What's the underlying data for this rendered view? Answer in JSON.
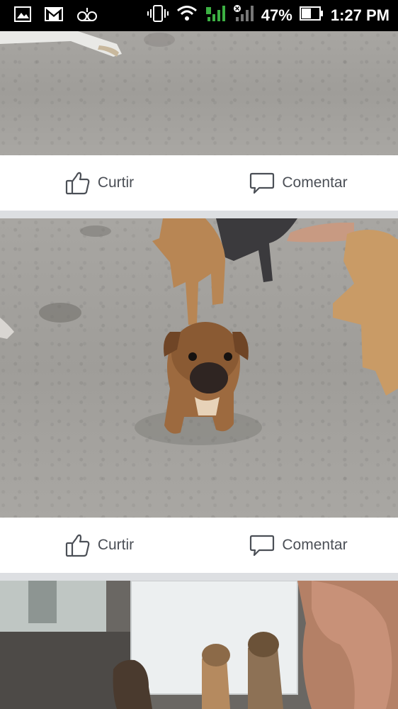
{
  "status_bar": {
    "battery": "47%",
    "time": "1:27 PM",
    "icons": [
      "image-notification-icon",
      "gmail-icon",
      "voicemail-icon",
      "vibrate-icon",
      "wifi-icon",
      "sim-signal-icon",
      "no-signal-icon",
      "battery-icon"
    ]
  },
  "posts": [
    {
      "like_label": "Curtir",
      "comment_label": "Comentar"
    },
    {
      "like_label": "Curtir",
      "comment_label": "Comentar"
    }
  ],
  "colors": {
    "action_text": "#4b4f56",
    "feed_bg": "#dddfe2",
    "card_bg": "#ffffff"
  }
}
